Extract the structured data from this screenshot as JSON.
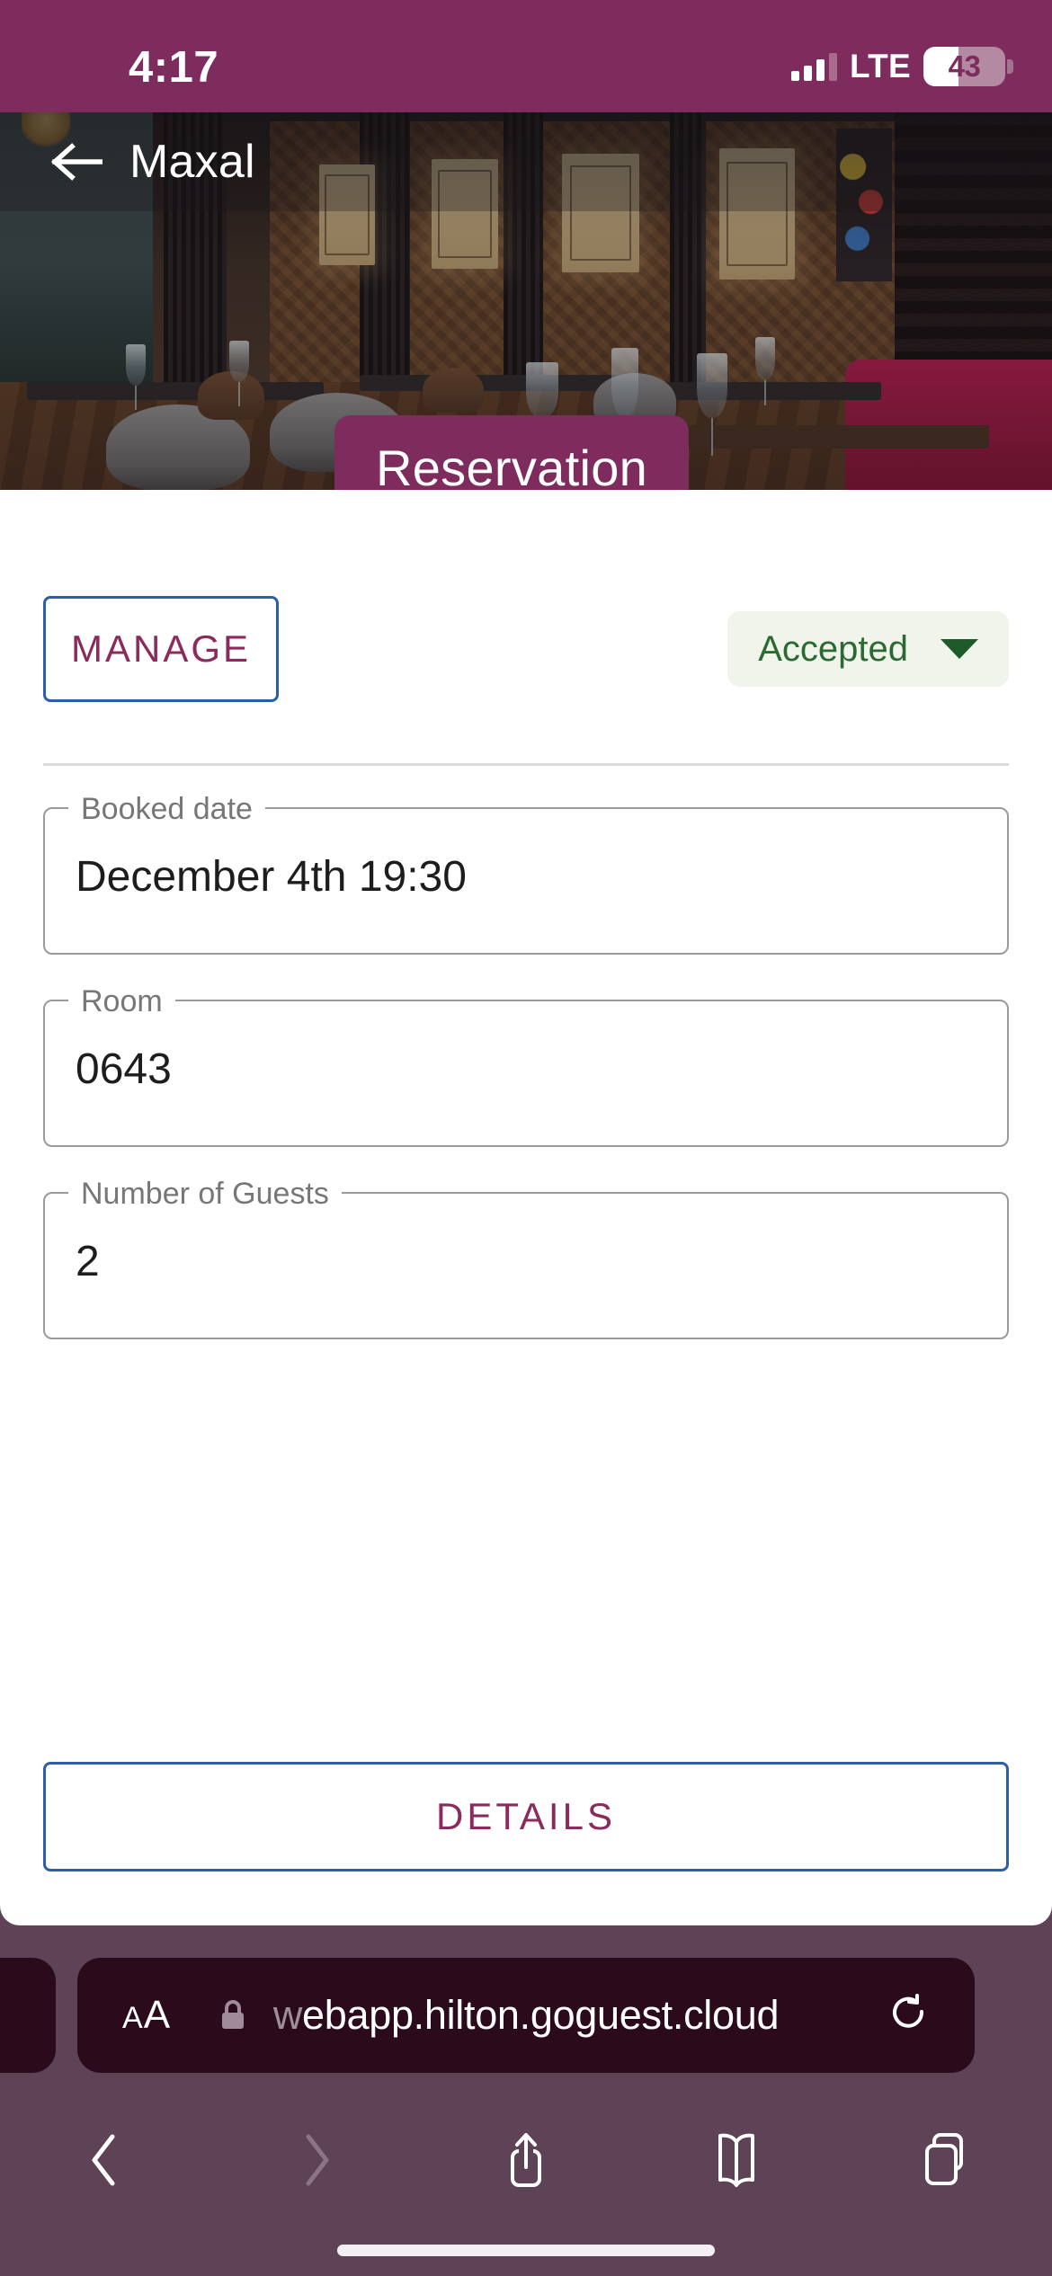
{
  "status_bar": {
    "time": "4:17",
    "network": "LTE",
    "battery_percent": "43",
    "signal_icon": "cellular-bars-icon",
    "battery_icon": "battery-icon"
  },
  "hero": {
    "back_icon": "back-arrow-icon",
    "title": "Maxal",
    "badge_label": "Reservation",
    "image_description": "restaurant-interior-photo"
  },
  "actions": {
    "manage_label": "MANAGE",
    "status_value": "Accepted",
    "status_caret_icon": "chevron-down-icon"
  },
  "fields": [
    {
      "label": "Booked date",
      "value": "December 4th 19:30"
    },
    {
      "label": "Room",
      "value": "0643"
    },
    {
      "label": "Number of Guests",
      "value": "2"
    }
  ],
  "footer": {
    "details_label": "DETAILS"
  },
  "browser": {
    "text_size_label": "A",
    "text_size_label_large": "A",
    "lock_icon": "lock-icon",
    "url_prefix": "w",
    "url": "ebapp.hilton.goguest.cloud",
    "url_full": "webapp.hilton.goguest.cloud",
    "reload_icon": "reload-icon",
    "toolbar": [
      {
        "name": "back",
        "icon": "chevron-left-icon"
      },
      {
        "name": "forward",
        "icon": "chevron-right-icon"
      },
      {
        "name": "share",
        "icon": "share-icon"
      },
      {
        "name": "bookmarks",
        "icon": "book-icon"
      },
      {
        "name": "tabs",
        "icon": "tabs-icon"
      }
    ]
  },
  "colors": {
    "brand_plum": "#7e2c5e",
    "chrome_plum": "#5d4355",
    "border_blue": "#2e5ea8",
    "status_green_bg": "#f0f4ea",
    "status_green_text": "#2c6a33"
  }
}
